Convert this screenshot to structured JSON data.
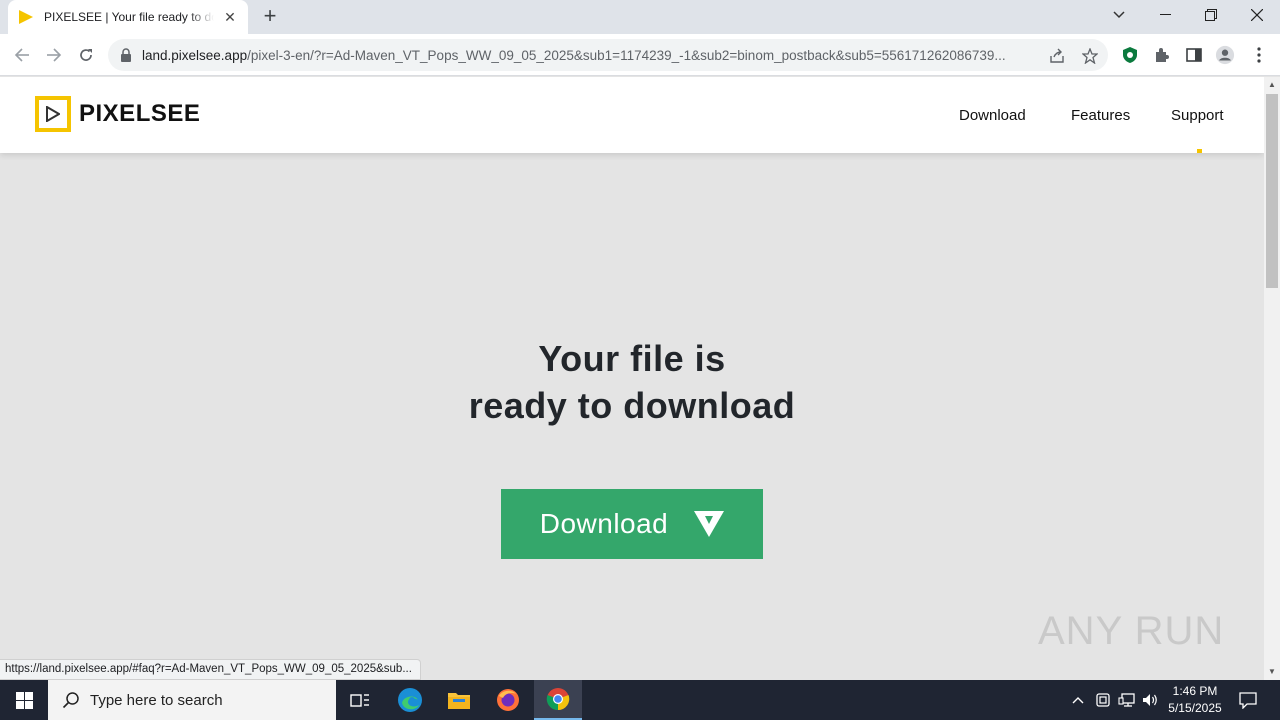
{
  "browser": {
    "tab_title": "PIXELSEE | Your file ready to download",
    "new_tab_symbol": "+",
    "url_host": "land.pixelsee.app",
    "url_path": "/pixel-3-en/?r=Ad-Maven_VT_Pops_WW_09_05_2025&sub1=1174239_-1&sub2=binom_postback&sub5=556171262086739...",
    "status_url": "https://land.pixelsee.app/#faq?r=Ad-Maven_VT_Pops_WW_09_05_2025&sub..."
  },
  "site": {
    "logo_text": "PIXELSEE",
    "nav": [
      "Download",
      "Features",
      "Support"
    ],
    "hero_line1": "Your file is",
    "hero_line2": "ready to download",
    "download_button": "Download",
    "accent_color": "#f5c400",
    "button_color": "#34a76b"
  },
  "watermark": "ANY RUN",
  "taskbar": {
    "search_placeholder": "Type here to search",
    "time": "1:46 PM",
    "date": "5/15/2025"
  }
}
